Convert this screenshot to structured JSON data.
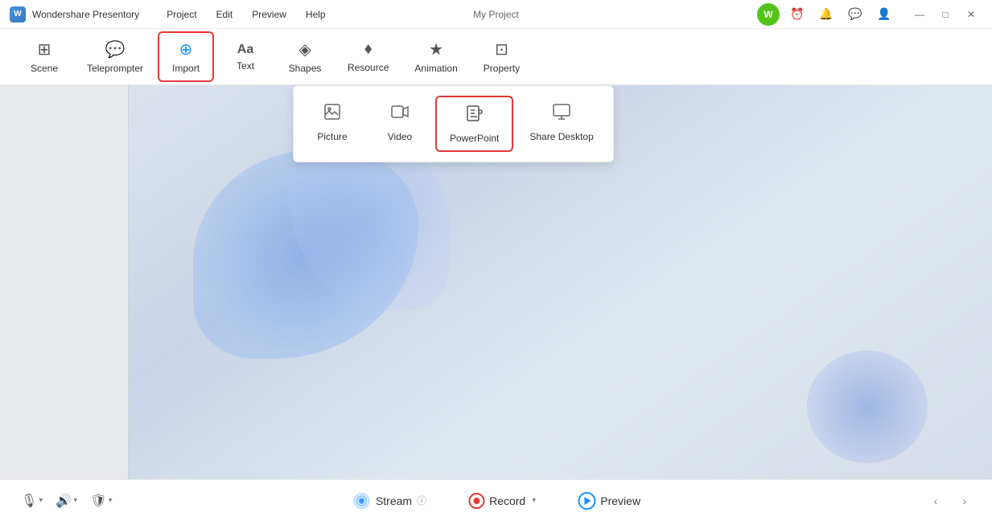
{
  "app": {
    "name": "Wondershare Presentory",
    "logo_letter": "W"
  },
  "title_bar": {
    "menu_items": [
      "Project",
      "Edit",
      "Preview",
      "Help"
    ],
    "project_name": "My Project",
    "window_controls": {
      "minimize": "—",
      "maximize": "□",
      "close": "✕"
    }
  },
  "toolbar": {
    "items": [
      {
        "id": "scene",
        "icon": "⊞",
        "label": "Scene"
      },
      {
        "id": "teleprompter",
        "icon": "💬",
        "label": "Teleprompter"
      },
      {
        "id": "import",
        "icon": "⊕",
        "label": "Import",
        "active": true
      },
      {
        "id": "text",
        "icon": "Aa",
        "label": "Text"
      },
      {
        "id": "shapes",
        "icon": "◈",
        "label": "Shapes"
      },
      {
        "id": "resource",
        "icon": "♦",
        "label": "Resource"
      },
      {
        "id": "animation",
        "icon": "★",
        "label": "Animation"
      },
      {
        "id": "property",
        "icon": "⊡",
        "label": "Property"
      }
    ]
  },
  "import_dropdown": {
    "items": [
      {
        "id": "picture",
        "icon": "🖼",
        "label": "Picture"
      },
      {
        "id": "video",
        "icon": "▶",
        "label": "Video"
      },
      {
        "id": "powerpoint",
        "icon": "📊",
        "label": "PowerPoint",
        "active": true
      },
      {
        "id": "share_desktop",
        "icon": "🖥",
        "label": "Share Desktop"
      }
    ]
  },
  "bottom_bar": {
    "mic_icon": "🎙",
    "volume_icon": "🔊",
    "shield_icon": "🛡",
    "stream_label": "Stream",
    "stream_info_icon": "ⓘ",
    "record_label": "Record",
    "preview_label": "Preview",
    "nav_prev": "‹",
    "nav_next": "›"
  }
}
